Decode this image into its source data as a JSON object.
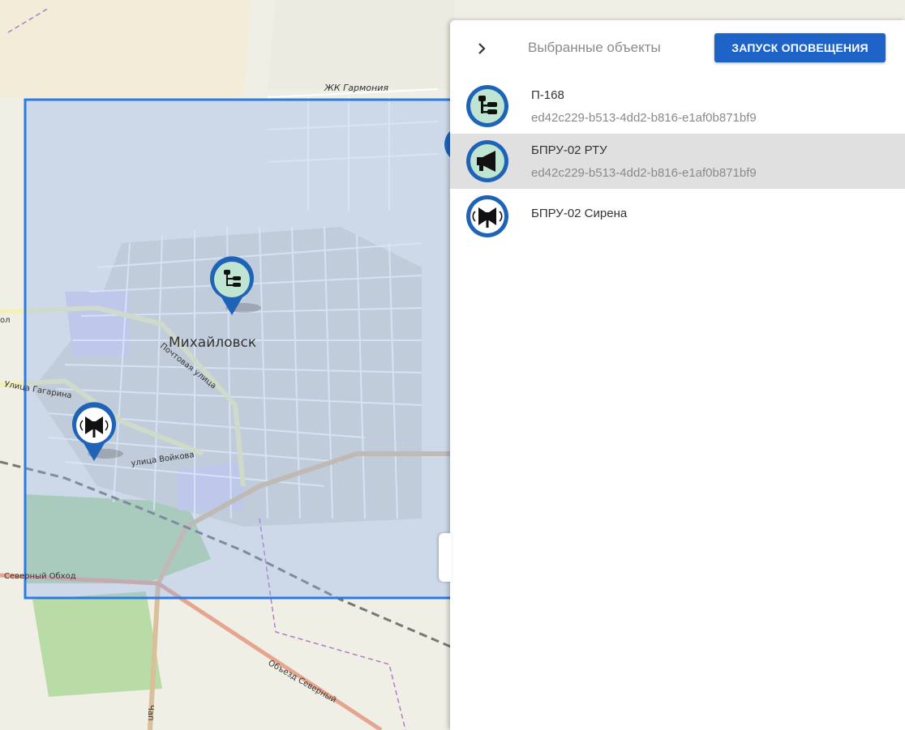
{
  "map": {
    "labels": {
      "town": "Михайловск",
      "district": "ЖК Гармония",
      "street_pochtovaya": "Почтовая улица",
      "street_gagarina": "Улица Гагарина",
      "street_voykova": "улица Войкова",
      "road_severny_obkhod": "Северный Обход",
      "road_obezd_severny": "Объезд Северный",
      "edge_left": "ол",
      "edge_bottom": "Чап"
    },
    "markers": [
      {
        "icon": "network-tree-icon",
        "name": "П-168"
      },
      {
        "icon": "siren-icon",
        "name": "БПРУ-02 Сирена"
      }
    ],
    "colors": {
      "selection": "#2d7ae0",
      "marker_blue": "#1e63b8",
      "marker_fill": "#bfe4d1"
    }
  },
  "panel": {
    "collapse_icon": "chevron-right-icon",
    "title": "Выбранные объекты",
    "launch_button": "ЗАПУСК ОПОВЕЩЕНИЯ",
    "items": [
      {
        "name": "П-168",
        "id": "ed42c229-b513-4dd2-b816-e1af0b871bf9",
        "icon": "network-tree-icon",
        "selected": false
      },
      {
        "name": "БПРУ-02 РТУ",
        "id": "ed42c229-b513-4dd2-b816-e1af0b871bf9",
        "icon": "megaphone-icon",
        "selected": true
      },
      {
        "name": "БПРУ-02 Сирена",
        "icon": "siren-icon",
        "selected": false
      }
    ],
    "accent_color": "#1e64c8"
  }
}
